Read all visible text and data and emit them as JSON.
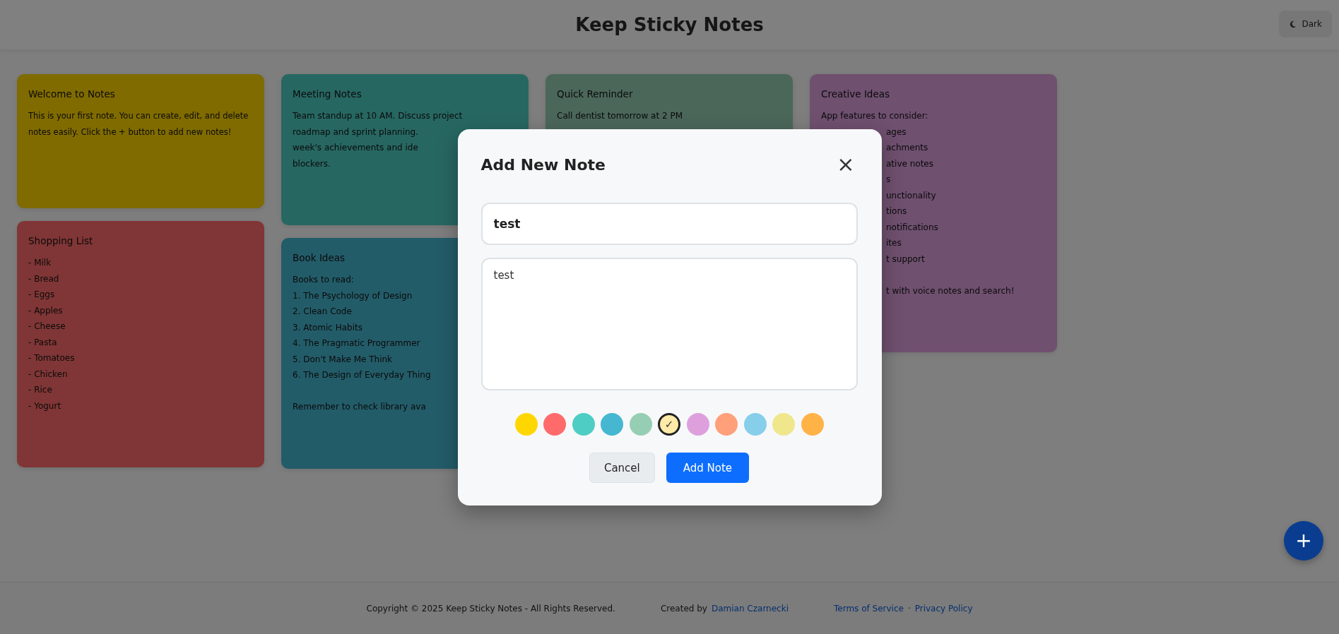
{
  "header": {
    "title": "Keep Sticky Notes",
    "theme_button": "Dark"
  },
  "note_columns": [
    {
      "notes": [
        {
          "title": "Welcome to Notes",
          "color": "#806b00",
          "paragraph": "This is your first note. You can create, edit, and delete notes easily. Click the + button to add new notes!"
        },
        {
          "title": "Shopping List",
          "color": "#803636",
          "lines": [
            {
              "text": "- Milk"
            },
            {
              "text": "- Bread"
            },
            {
              "text": "- Eggs"
            },
            {
              "text": "- Apples"
            },
            {
              "text": "- Cheese"
            },
            {
              "text": "- Pasta"
            },
            {
              "text": "- Tomatoes"
            },
            {
              "text": "- Chicken"
            },
            {
              "text": "- Rice"
            },
            {
              "text": "- Yogurt"
            }
          ]
        }
      ]
    },
    {
      "notes": [
        {
          "title": "Meeting Notes",
          "color": "#276762",
          "lines": [
            {
              "text": "Team standup at 10 AM. Discuss project"
            },
            {
              "text": "roadmap and sprint planning."
            },
            {
              "text": "week's achievements and ide"
            },
            {
              "text": "blockers."
            }
          ]
        },
        {
          "title": "Book Ideas",
          "color": "#235c69",
          "lines": [
            {
              "text": "Books to read:"
            },
            {
              "text": "1. The Psychology of Design"
            },
            {
              "text": "2. Clean Code"
            },
            {
              "text": "3. Atomic Habits"
            },
            {
              "text": "4. The Pragmatic Programmer"
            },
            {
              "text": "5. Don't Make Me Think"
            },
            {
              "text": "6. The Design of Everyday Thing"
            },
            {
              "text": "Remember to check library ava",
              "space_before": true
            }
          ]
        }
      ]
    },
    {
      "notes": [
        {
          "title": "Quick Reminder",
          "color": "#4b675a",
          "lines": [
            {
              "text": "Call dentist tomorrow at 2 PM"
            }
          ]
        }
      ]
    },
    {
      "notes": [
        {
          "title": "Creative Ideas",
          "color": "#6f506f",
          "lines": [
            {
              "text": "App features to consider:"
            },
            {
              "text": "ages",
              "cut": true
            },
            {
              "text": "achments",
              "cut": true
            },
            {
              "text": "ative notes",
              "cut": true
            },
            {
              "text": "s",
              "cut": true
            },
            {
              "text": "unctionality",
              "cut": true
            },
            {
              "text": "tions",
              "cut": true
            },
            {
              "text": "notifications",
              "cut": true
            },
            {
              "text": "ites",
              "cut": true
            },
            {
              "text": "t support",
              "cut": true
            },
            {
              "text": "t with voice notes and search!",
              "cut": true,
              "space_before": true
            }
          ]
        }
      ]
    }
  ],
  "footer": {
    "copyright": "Copyright © 2025 Keep Sticky Notes - All Rights Reserved.",
    "created_by": "Created by",
    "author_link": "Damian Czarnecki",
    "links": [
      "Terms of Service",
      "Privacy Policy"
    ],
    "separator": "·"
  },
  "fab": "+",
  "modal": {
    "title": "Add New Note",
    "close": "×",
    "title_value": "test",
    "content_value": "test",
    "check_glyph": "✓",
    "swatches": [
      {
        "color": "#ffd700",
        "selected": false
      },
      {
        "color": "#ff6b6b",
        "selected": false
      },
      {
        "color": "#4ecdc4",
        "selected": false
      },
      {
        "color": "#45b7d1",
        "selected": false
      },
      {
        "color": "#96ceb4",
        "selected": false
      },
      {
        "color": "#ffeaa7",
        "selected": true
      },
      {
        "color": "#dda0dd",
        "selected": false
      },
      {
        "color": "#ffa07a",
        "selected": false
      },
      {
        "color": "#87ceeb",
        "selected": false
      },
      {
        "color": "#f0e68c",
        "selected": false
      },
      {
        "color": "#ffb347",
        "selected": false
      }
    ],
    "cancel": "Cancel",
    "submit": "Add Note"
  }
}
